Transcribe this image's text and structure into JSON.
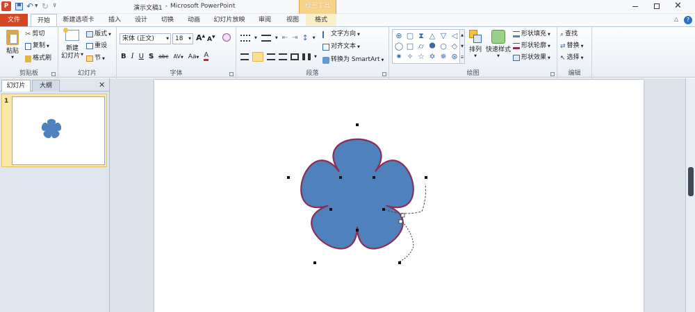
{
  "title_bar": {
    "document_name": "演示文稿1",
    "separator": "-",
    "app_name": "Microsoft PowerPoint",
    "contextual_tab_group": "绘图工具",
    "accent_color": "#d24726"
  },
  "tabs": {
    "file": "文件",
    "home": "开始",
    "new_tab": "新建选项卡",
    "insert": "插入",
    "design": "设计",
    "transitions": "切换",
    "animations": "动画",
    "slideshow": "幻灯片放映",
    "review": "审阅",
    "view": "视图",
    "format": "格式"
  },
  "ribbon": {
    "clipboard": {
      "paste": "粘贴",
      "cut": "剪切",
      "copy": "复制",
      "format_painter": "格式刷",
      "label": "剪贴板"
    },
    "slides": {
      "new_slide_top": "新建",
      "new_slide_bottom": "幻灯片",
      "layout": "版式",
      "reset": "重设",
      "section": "节",
      "label": "幻灯片"
    },
    "font": {
      "name": "宋体 (正文)",
      "size": "18",
      "bold": "B",
      "italic": "I",
      "underline": "U",
      "shadow": "S",
      "strike": "abc",
      "spacing": "AV",
      "case": "Aa",
      "color_letter": "A",
      "grow": "A",
      "shrink": "A",
      "label": "字体"
    },
    "paragraph": {
      "text_direction": "文字方向",
      "align_text": "对齐文本",
      "smartart": "转换为 SmartArt",
      "label": "段落"
    },
    "drawing": {
      "arrange": "排列",
      "quick_styles": "快速样式",
      "shape_fill": "形状填充",
      "shape_outline": "形状轮廓",
      "shape_effects": "形状效果",
      "label": "绘图"
    },
    "editing": {
      "find": "查找",
      "replace": "替换",
      "select": "选择",
      "label": "编辑"
    }
  },
  "pane": {
    "tab_slides": "幻灯片",
    "tab_outline": "大纲",
    "slide_number": "1"
  },
  "shape": {
    "fill": "#4f81bd",
    "outline": "#8b2e55"
  }
}
